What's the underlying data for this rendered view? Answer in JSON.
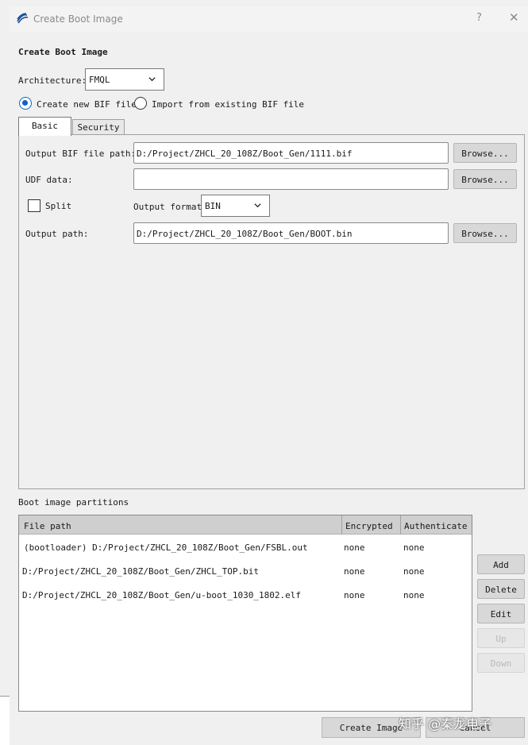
{
  "window": {
    "title": "Create Boot Image",
    "help": "?",
    "close": "✕"
  },
  "heading": "Create Boot Image",
  "architecture": {
    "label": "Architecture:",
    "value": "FMQL"
  },
  "mode": {
    "create_new_label": "Create new BIF file",
    "import_label": "Import from existing BIF file",
    "selected": "create_new"
  },
  "tabs": [
    {
      "label": "Basic",
      "active": true
    },
    {
      "label": "Security",
      "active": false
    }
  ],
  "basic": {
    "output_bif_label": "Output BIF file path:",
    "output_bif_value": "D:/Project/ZHCL_20_108Z/Boot_Gen/1111.bif",
    "udf_label": "UDF data:",
    "udf_value": "",
    "split_label": "Split",
    "split_checked": false,
    "output_format_label": "Output format",
    "output_format_value": "BIN",
    "output_path_label": "Output path:",
    "output_path_value": "D:/Project/ZHCL_20_108Z/Boot_Gen/BOOT.bin",
    "browse_label": "Browse..."
  },
  "partitions": {
    "label": "Boot image partitions",
    "columns": [
      "File path",
      "Encrypted",
      "Authenticate"
    ],
    "rows": [
      {
        "path": "(bootloader) D:/Project/ZHCL_20_108Z/Boot_Gen/FSBL.out",
        "encrypted": "none",
        "authenticate": "none"
      },
      {
        "path": "D:/Project/ZHCL_20_108Z/Boot_Gen/ZHCL_TOP.bit",
        "encrypted": "none",
        "authenticate": "none"
      },
      {
        "path": "D:/Project/ZHCL_20_108Z/Boot_Gen/u-boot_1030_1802.elf",
        "encrypted": "none",
        "authenticate": "none"
      }
    ],
    "buttons": {
      "add": "Add",
      "delete": "Delete",
      "edit": "Edit",
      "up": "Up",
      "down": "Down"
    }
  },
  "footer": {
    "create": "Create Image",
    "cancel": "Cancel"
  },
  "watermark": "知乎 @秦龙电子",
  "colors": {
    "accent": "#0a64c8",
    "header_bg": "#cfcfcf",
    "button_bg": "#d8d8d8"
  }
}
